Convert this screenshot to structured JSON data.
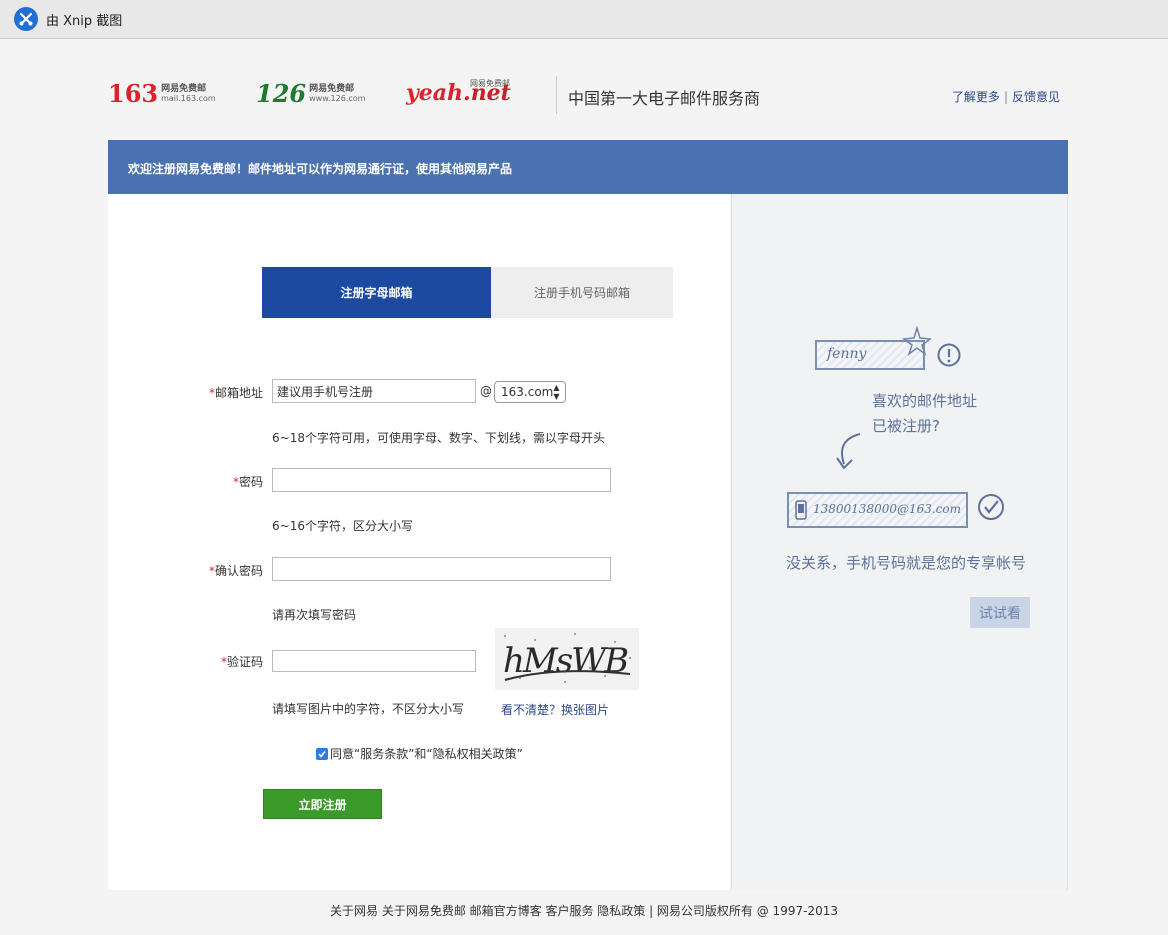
{
  "xnip": {
    "title": "由 Xnip 截图"
  },
  "header": {
    "logo163": {
      "num": "163",
      "cn": "网易免费邮",
      "domain": "mail.163.com"
    },
    "logo126": {
      "num": "126",
      "cn": "网易免费邮",
      "domain": "www.126.com"
    },
    "logoyeah": {
      "word": "yeah",
      "suffix": ".net",
      "cn": "网易免费邮"
    },
    "slogan": "中国第一大电子邮件服务商",
    "link_more": "了解更多",
    "link_sep": "|",
    "link_feedback": "反馈意见"
  },
  "banner": {
    "text": "欢迎注册网易免费邮！邮件地址可以作为网易通行证，使用其他网易产品"
  },
  "tabs": {
    "letter": "注册字母邮箱",
    "phone": "注册手机号码邮箱"
  },
  "form": {
    "required_mark": "*",
    "email_label": "邮箱地址",
    "email_value": "建议用手机号注册",
    "at": "@",
    "domain_selected": "163.com",
    "email_hint": "6~18个字符可用，可使用字母、数字、下划线，需以字母开头",
    "password_label": "密码",
    "password_hint": "6~16个字符，区分大小写",
    "confirm_label": "确认密码",
    "confirm_hint": "请再次填写密码",
    "captcha_label": "验证码",
    "captcha_text": "hMsWB",
    "captcha_hint": "请填写图片中的字符，不区分大小写",
    "captcha_change": "看不清楚？换张图片",
    "agree": "同意“服务条款”和“隐私权相关政策”",
    "agree_checked": true,
    "submit": "立即注册"
  },
  "promo": {
    "sample_name": "fenny",
    "question_line1": "喜欢的邮件地址",
    "question_line2": "已被注册?",
    "sample_phone_email": "13800138000@163.com",
    "answer": "没关系，手机号码就是您的专享帐号",
    "try_button": "试试看"
  },
  "footer": {
    "text": "关于网易 关于网易免费邮 邮箱官方博客 客户服务 隐私政策 | 网易公司版权所有 @ 1997-2013"
  },
  "colors": {
    "banner": "#4a72b0",
    "tab_active": "#1b4aa0",
    "submit": "#3a9a2a",
    "logo_red": "#d9232d",
    "logo_green": "#1f7a32"
  }
}
